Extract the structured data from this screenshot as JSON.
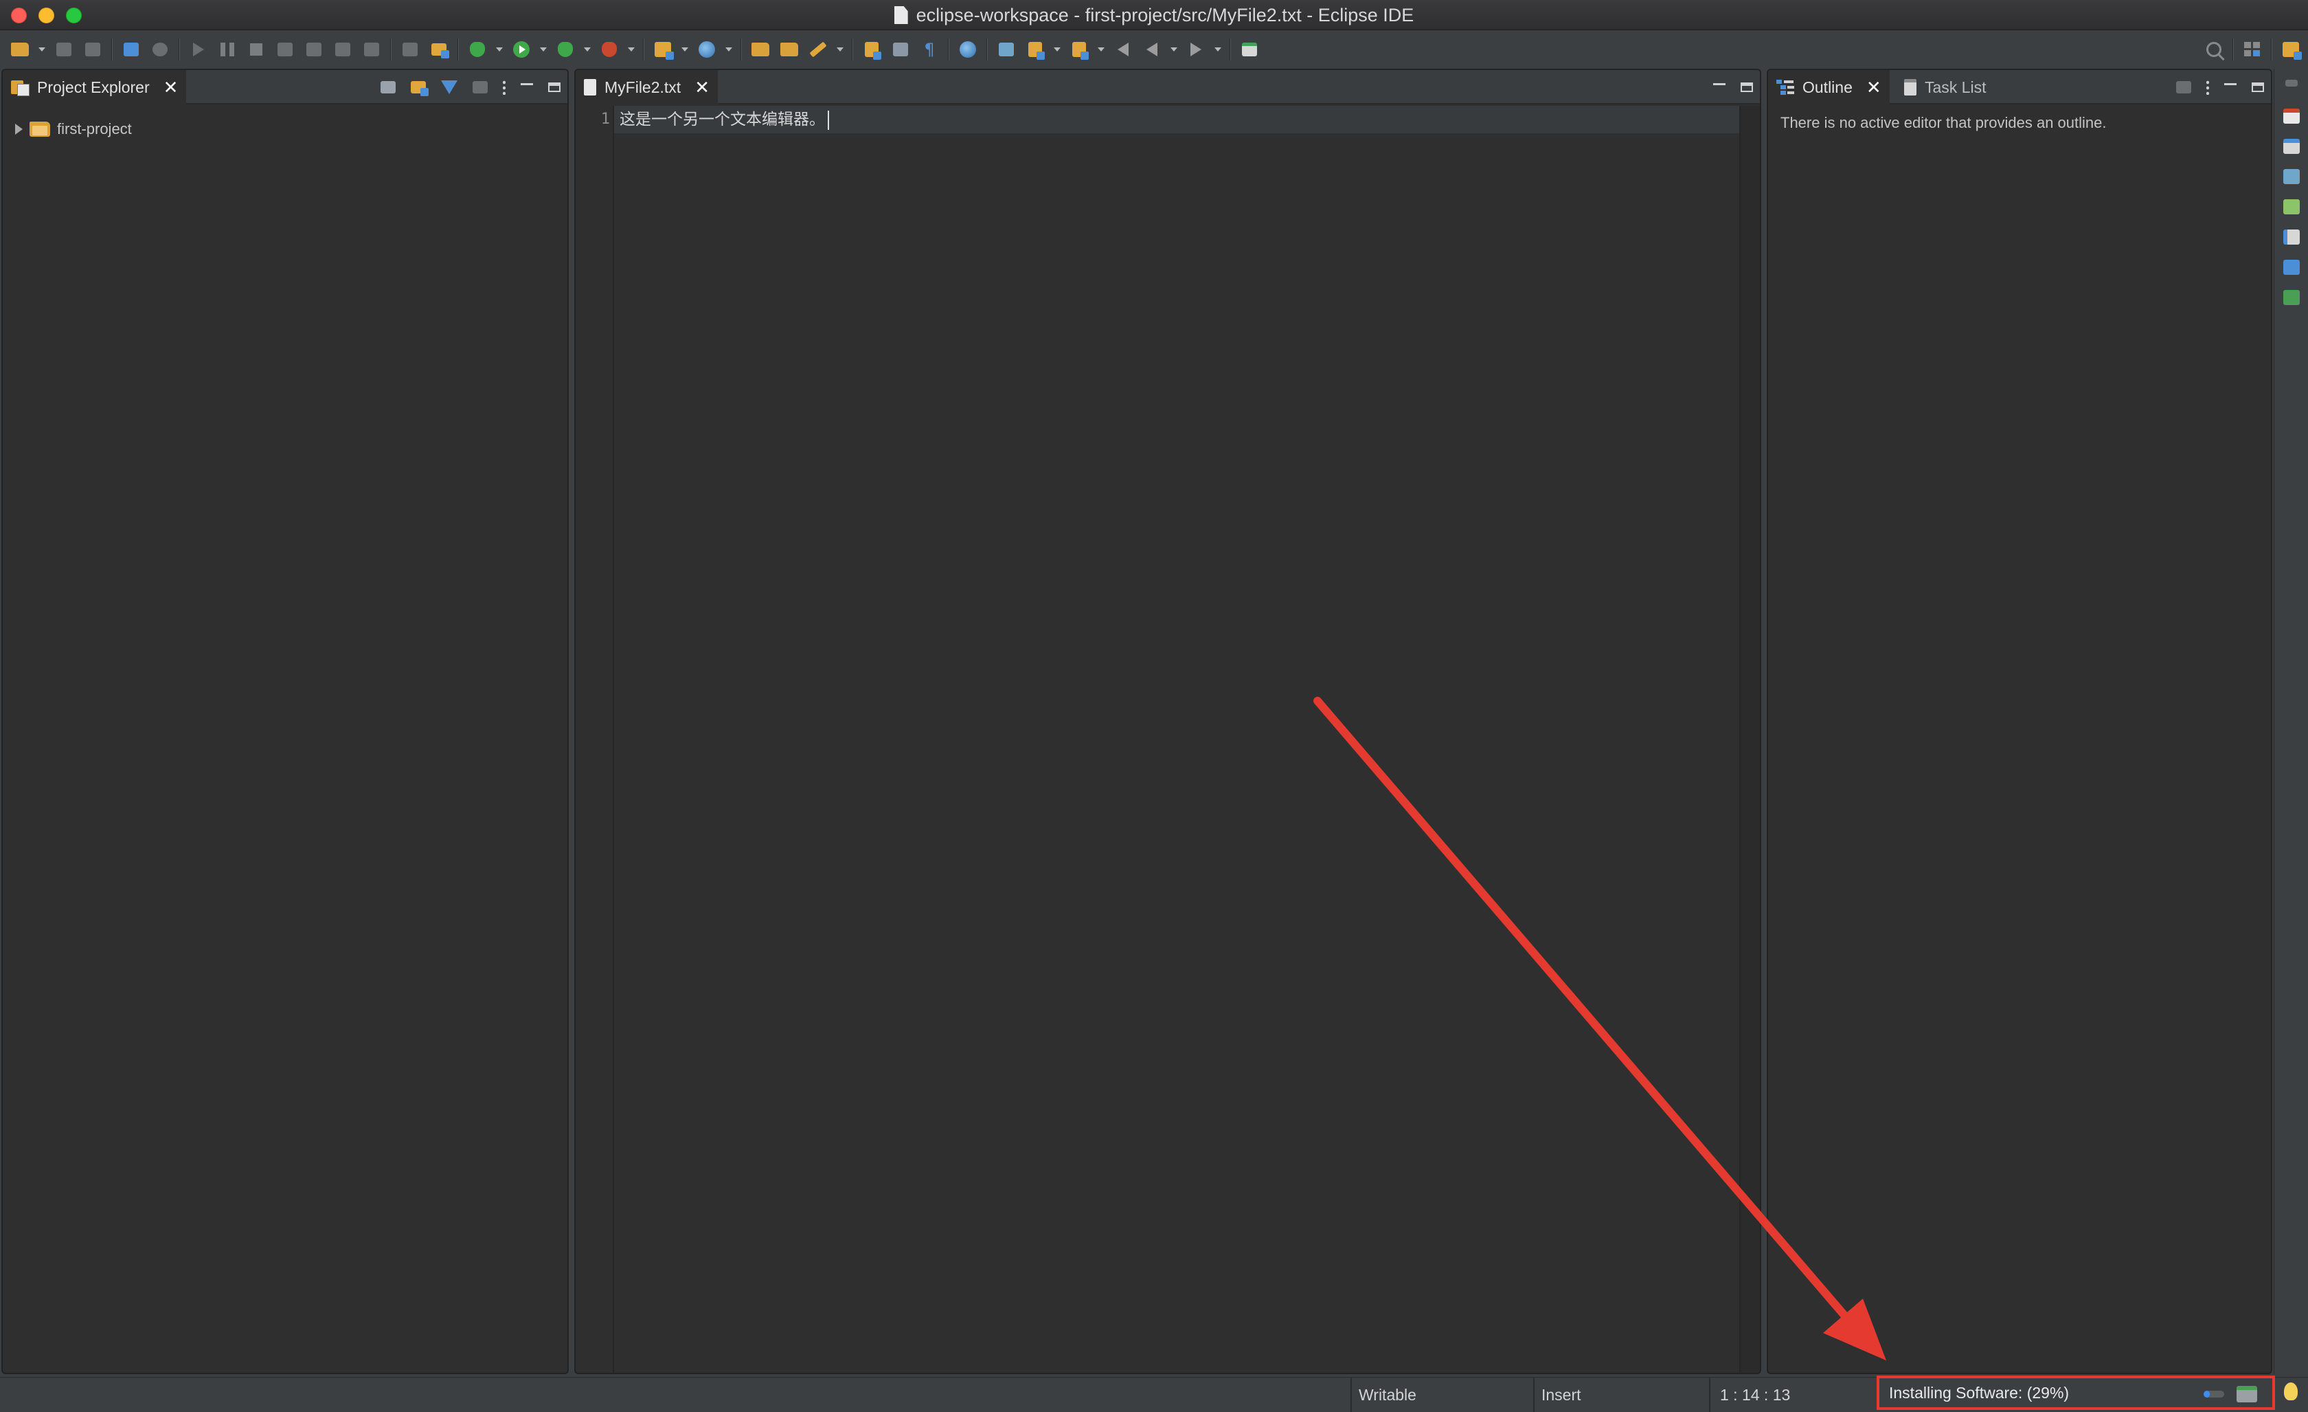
{
  "window": {
    "title": "eclipse-workspace - first-project/src/MyFile2.txt - Eclipse IDE"
  },
  "project_explorer": {
    "tab_label": "Project Explorer",
    "tree": [
      {
        "label": "first-project"
      }
    ]
  },
  "editor": {
    "tab_label": "MyFile2.txt",
    "lines": [
      {
        "number": "1",
        "text": "这是一个另一个文本编辑器。"
      }
    ]
  },
  "right_panel": {
    "tabs": [
      {
        "label": "Outline"
      },
      {
        "label": "Task List"
      }
    ],
    "outline_message": "There is no active editor that provides an outline."
  },
  "status_bar": {
    "writable": "Writable",
    "insert_mode": "Insert",
    "position": "1 : 14 : 13",
    "progress_label": "Installing Software: (29%)",
    "progress_fraction": 0.29
  },
  "colors": {
    "annotation_red": "#e53a30",
    "accent_blue": "#3e8cf0"
  },
  "icons": {
    "toolbar": [
      "new-wizard-icon",
      "save-icon",
      "save-all-icon",
      "open-console-icon",
      "skip-breakpoints-icon",
      "resume-icon",
      "suspend-icon",
      "terminate-icon",
      "disconnect-icon",
      "step-into-icon",
      "step-over-icon",
      "step-return-icon",
      "drop-to-frame-icon",
      "use-step-filters-icon",
      "debug-icon",
      "run-icon",
      "coverage-icon",
      "external-tools-icon",
      "new-java-package-icon",
      "new-class-icon",
      "open-type-icon",
      "open-task-icon",
      "search-icon",
      "edit-icon",
      "toggle-mark-occurrences-icon",
      "toggle-block-selection-icon",
      "show-whitespace-icon",
      "globe-icon",
      "next-annotation-icon",
      "previous-annotation-icon",
      "last-edit-location-icon",
      "back-icon",
      "forward-icon",
      "pin-editor-icon",
      "quick-access-search-icon",
      "open-perspective-icon",
      "java-perspective-icon"
    ]
  }
}
